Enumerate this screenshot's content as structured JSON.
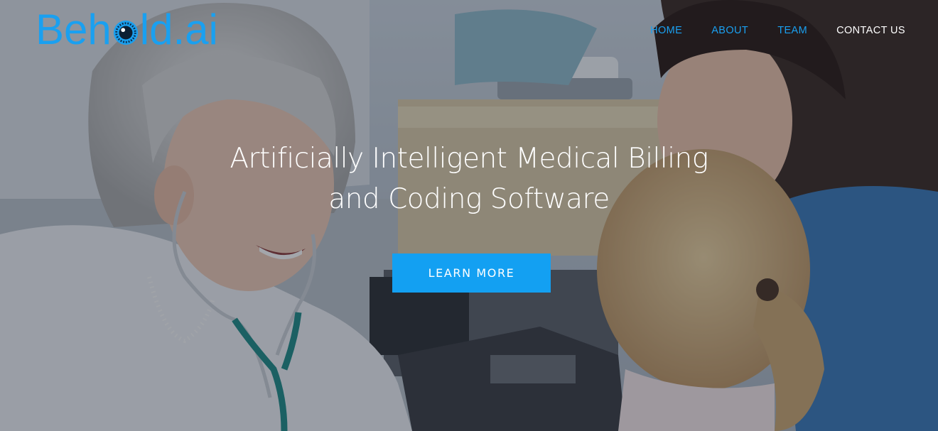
{
  "brand": {
    "logo_before": "Beh",
    "logo_after": "ld.ai",
    "logo_full": "Behold.ai",
    "color": "#1aa0f0"
  },
  "nav": {
    "items": [
      {
        "label": "HOME",
        "active": false
      },
      {
        "label": "ABOUT",
        "active": false
      },
      {
        "label": "TEAM",
        "active": false
      },
      {
        "label": "CONTACT US",
        "active": true
      }
    ]
  },
  "hero": {
    "headline_line1": "Artificially Intelligent Medical Billing",
    "headline_line2": "and Coding Software",
    "cta_label": "LEARN MORE",
    "cta_color": "#13a0f2",
    "background_description_icon": "doctor-with-child-photo"
  }
}
